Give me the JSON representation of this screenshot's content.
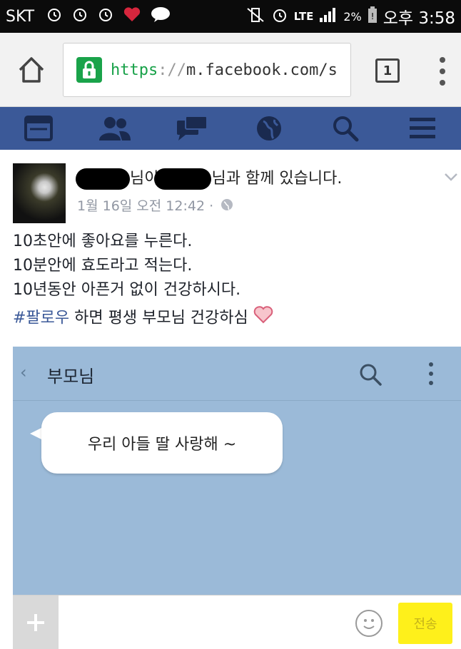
{
  "status_bar": {
    "carrier": "SKT",
    "network": "LTE",
    "battery": "2%",
    "time": "오후 3:58",
    "icons": [
      "alarm-icon",
      "alarm-icon",
      "alarm-icon",
      "heart-app-icon",
      "talk-icon",
      "vibrate-icon",
      "alarm-icon",
      "signal-icon",
      "battery-icon"
    ]
  },
  "browser": {
    "url_scheme": "https",
    "url_sep": "://",
    "url_rest": "m.facebook.com/s",
    "tab_count": "1"
  },
  "fb_nav": {
    "icons": [
      "news-feed-icon",
      "friends-icon",
      "messages-icon",
      "notifications-globe-icon",
      "search-icon",
      "menu-icon"
    ]
  },
  "post": {
    "author_part1": "님이",
    "author_part2": "님과 함께 있습니다.",
    "time": "1월 16일 오전 12:42 ·",
    "line1": "10초안에 좋아요를 누른다.",
    "line2": "10분안에 효도라고 적는다.",
    "line3": "10년동안 아픈거 없이 건강하시다.",
    "hashtag": "#팔로우",
    "line4_rest": " 하면 평생 부모님 건강하심"
  },
  "chat": {
    "back": "‹",
    "title": "부모님",
    "bubble": "우리 아들 딸 사랑해 ~",
    "send": "전송"
  },
  "colors": {
    "facebook_blue": "#3b5998",
    "chat_bg": "#9bbad8",
    "send_yellow": "#fef01b",
    "secure_green": "#17a148"
  }
}
